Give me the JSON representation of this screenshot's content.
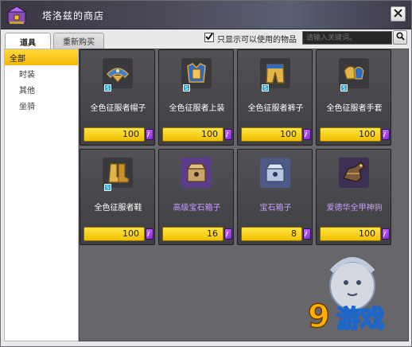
{
  "window": {
    "title": "塔洛兹的商店"
  },
  "tabs": [
    {
      "label": "道具",
      "active": true
    },
    {
      "label": "重新购买",
      "active": false
    }
  ],
  "filter": {
    "label": "只显示可以使用的物品",
    "checked": true
  },
  "search": {
    "placeholder": "请输入关键词。"
  },
  "sidebar": {
    "items": [
      {
        "label": "全部",
        "selected": true
      },
      {
        "label": "时装",
        "selected": false
      },
      {
        "label": "其他",
        "selected": false
      },
      {
        "label": "坐骑",
        "selected": false
      }
    ]
  },
  "items": [
    {
      "name": "全色征服者帽子",
      "price": "100",
      "icon": "helmet-icon",
      "name_color": "#ffffff"
    },
    {
      "name": "全色征服者上装",
      "price": "100",
      "icon": "armor-top-icon",
      "name_color": "#ffffff"
    },
    {
      "name": "全色征服者裤子",
      "price": "100",
      "icon": "pants-icon",
      "name_color": "#ffffff"
    },
    {
      "name": "全色征服者手套",
      "price": "100",
      "icon": "gloves-icon",
      "name_color": "#ffffff"
    },
    {
      "name": "全色征服者鞋",
      "price": "100",
      "icon": "boots-icon",
      "name_color": "#ffffff"
    },
    {
      "name": "高级宝石箱子",
      "price": "16",
      "icon": "gem-box-icon",
      "name_color": "#c89cff"
    },
    {
      "name": "宝石箱子",
      "price": "8",
      "icon": "gem-box-silver-icon",
      "name_color": "#c89cff"
    },
    {
      "name": "爱德华全甲神驹",
      "price": "100",
      "icon": "mount-icon",
      "name_color": "#c89cff"
    }
  ],
  "watermark": {
    "text": "游戏",
    "brand": "9"
  },
  "colors": {
    "accent": "#f3c400",
    "currency": "#a84ff0",
    "title_text": "#ffffff"
  }
}
